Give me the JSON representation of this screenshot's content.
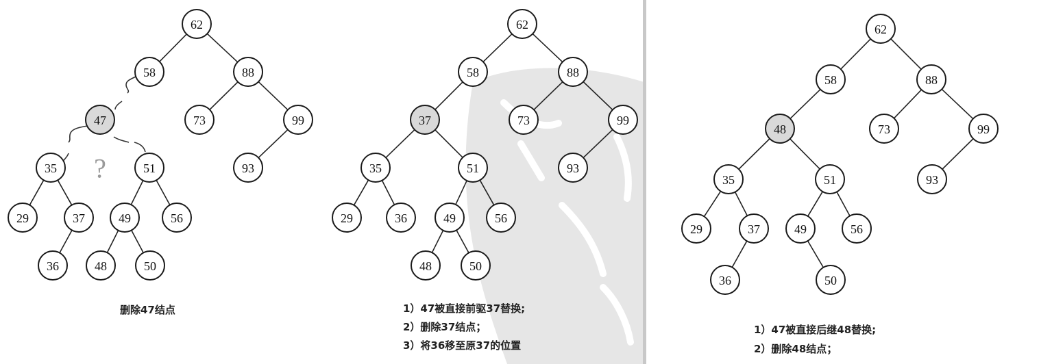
{
  "panels": [
    {
      "id": "left",
      "question_mark": "?",
      "caption_lines": [
        "删除47结点"
      ],
      "nodes": [
        {
          "id": "n62",
          "label": "62",
          "highlight": false
        },
        {
          "id": "n58",
          "label": "58",
          "highlight": false
        },
        {
          "id": "n88",
          "label": "88",
          "highlight": false
        },
        {
          "id": "n47",
          "label": "47",
          "highlight": true
        },
        {
          "id": "n73",
          "label": "73",
          "highlight": false
        },
        {
          "id": "n99",
          "label": "99",
          "highlight": false
        },
        {
          "id": "n35",
          "label": "35",
          "highlight": false
        },
        {
          "id": "n51",
          "label": "51",
          "highlight": false
        },
        {
          "id": "n93",
          "label": "93",
          "highlight": false
        },
        {
          "id": "n29",
          "label": "29",
          "highlight": false
        },
        {
          "id": "n37",
          "label": "37",
          "highlight": false
        },
        {
          "id": "n49",
          "label": "49",
          "highlight": false
        },
        {
          "id": "n56",
          "label": "56",
          "highlight": false
        },
        {
          "id": "n36",
          "label": "36",
          "highlight": false
        },
        {
          "id": "n48",
          "label": "48",
          "highlight": false
        },
        {
          "id": "n50",
          "label": "50",
          "highlight": false
        }
      ],
      "edges": [
        [
          "n62",
          "n58"
        ],
        [
          "n62",
          "n88"
        ],
        [
          "n88",
          "n73"
        ],
        [
          "n88",
          "n99"
        ],
        [
          "n99",
          "n93"
        ],
        [
          "n35",
          "n29"
        ],
        [
          "n35",
          "n37"
        ],
        [
          "n37",
          "n36"
        ],
        [
          "n51",
          "n49"
        ],
        [
          "n51",
          "n56"
        ],
        [
          "n49",
          "n48"
        ],
        [
          "n49",
          "n50"
        ]
      ]
    },
    {
      "id": "middle",
      "caption_lines": [
        "1）47被直接前驱37替换;",
        "2）删除37结点；",
        "3）将36移至原37的位置"
      ],
      "nodes": [
        {
          "id": "n62",
          "label": "62",
          "highlight": false
        },
        {
          "id": "n58",
          "label": "58",
          "highlight": false
        },
        {
          "id": "n88",
          "label": "88",
          "highlight": false
        },
        {
          "id": "n37",
          "label": "37",
          "highlight": true
        },
        {
          "id": "n73",
          "label": "73",
          "highlight": false
        },
        {
          "id": "n99",
          "label": "99",
          "highlight": false
        },
        {
          "id": "n35",
          "label": "35",
          "highlight": false
        },
        {
          "id": "n51",
          "label": "51",
          "highlight": false
        },
        {
          "id": "n93",
          "label": "93",
          "highlight": false
        },
        {
          "id": "n29",
          "label": "29",
          "highlight": false
        },
        {
          "id": "n36",
          "label": "36",
          "highlight": false
        },
        {
          "id": "n49",
          "label": "49",
          "highlight": false
        },
        {
          "id": "n56",
          "label": "56",
          "highlight": false
        },
        {
          "id": "n48",
          "label": "48",
          "highlight": false
        },
        {
          "id": "n50",
          "label": "50",
          "highlight": false
        }
      ],
      "edges": [
        [
          "n62",
          "n58"
        ],
        [
          "n62",
          "n88"
        ],
        [
          "n58",
          "n37"
        ],
        [
          "n88",
          "n73"
        ],
        [
          "n88",
          "n99"
        ],
        [
          "n37",
          "n35"
        ],
        [
          "n37",
          "n51"
        ],
        [
          "n99",
          "n93"
        ],
        [
          "n35",
          "n29"
        ],
        [
          "n35",
          "n36"
        ],
        [
          "n51",
          "n49"
        ],
        [
          "n51",
          "n56"
        ],
        [
          "n49",
          "n48"
        ],
        [
          "n49",
          "n50"
        ]
      ]
    },
    {
      "id": "right",
      "caption_lines": [
        "1）47被直接后继48替换;",
        "2）删除48结点；"
      ],
      "nodes": [
        {
          "id": "n62",
          "label": "62",
          "highlight": false
        },
        {
          "id": "n58",
          "label": "58",
          "highlight": false
        },
        {
          "id": "n88",
          "label": "88",
          "highlight": false
        },
        {
          "id": "n48",
          "label": "48",
          "highlight": true
        },
        {
          "id": "n73",
          "label": "73",
          "highlight": false
        },
        {
          "id": "n99",
          "label": "99",
          "highlight": false
        },
        {
          "id": "n35",
          "label": "35",
          "highlight": false
        },
        {
          "id": "n51",
          "label": "51",
          "highlight": false
        },
        {
          "id": "n93",
          "label": "93",
          "highlight": false
        },
        {
          "id": "n29",
          "label": "29",
          "highlight": false
        },
        {
          "id": "n37",
          "label": "37",
          "highlight": false
        },
        {
          "id": "n49",
          "label": "49",
          "highlight": false
        },
        {
          "id": "n56",
          "label": "56",
          "highlight": false
        },
        {
          "id": "n36",
          "label": "36",
          "highlight": false
        },
        {
          "id": "n50",
          "label": "50",
          "highlight": false
        }
      ],
      "edges": [
        [
          "n62",
          "n58"
        ],
        [
          "n62",
          "n88"
        ],
        [
          "n58",
          "n48"
        ],
        [
          "n88",
          "n73"
        ],
        [
          "n88",
          "n99"
        ],
        [
          "n48",
          "n35"
        ],
        [
          "n48",
          "n51"
        ],
        [
          "n99",
          "n93"
        ],
        [
          "n35",
          "n29"
        ],
        [
          "n35",
          "n37"
        ],
        [
          "n37",
          "n36"
        ],
        [
          "n51",
          "n49"
        ],
        [
          "n51",
          "n56"
        ],
        [
          "n49",
          "n50"
        ]
      ]
    }
  ]
}
